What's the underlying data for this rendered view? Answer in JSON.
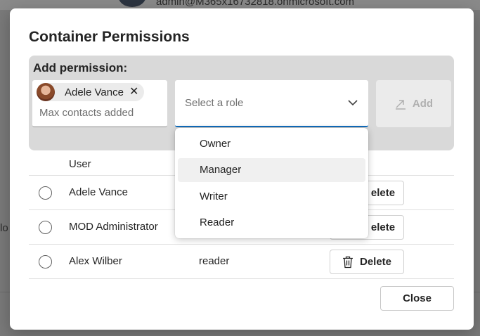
{
  "background": {
    "email": "admin@M365x16732818.onmicrosoft.com",
    "left_fragment": "lo"
  },
  "dialog": {
    "title": "Container Permissions",
    "add_permission_label": "Add permission:",
    "picker": {
      "selected_person": "Adele Vance",
      "helper_text": "Max contacts added"
    },
    "role_select": {
      "placeholder": "Select a role",
      "options": [
        "Owner",
        "Manager",
        "Writer",
        "Reader"
      ],
      "hovered_option": "Manager"
    },
    "add_button_label": "Add",
    "table": {
      "columns": [
        "User"
      ],
      "rows": [
        {
          "user": "Adele Vance",
          "role": ""
        },
        {
          "user": "MOD Administrator",
          "role": ""
        },
        {
          "user": "Alex Wilber",
          "role": "reader"
        }
      ],
      "delete_label": "Delete",
      "delete_partial_label": "elete"
    },
    "close_button_label": "Close"
  },
  "colors": {
    "accent": "#0f6cbd",
    "panel": "#d9d9d9",
    "overlay": "#7a7a7a"
  }
}
